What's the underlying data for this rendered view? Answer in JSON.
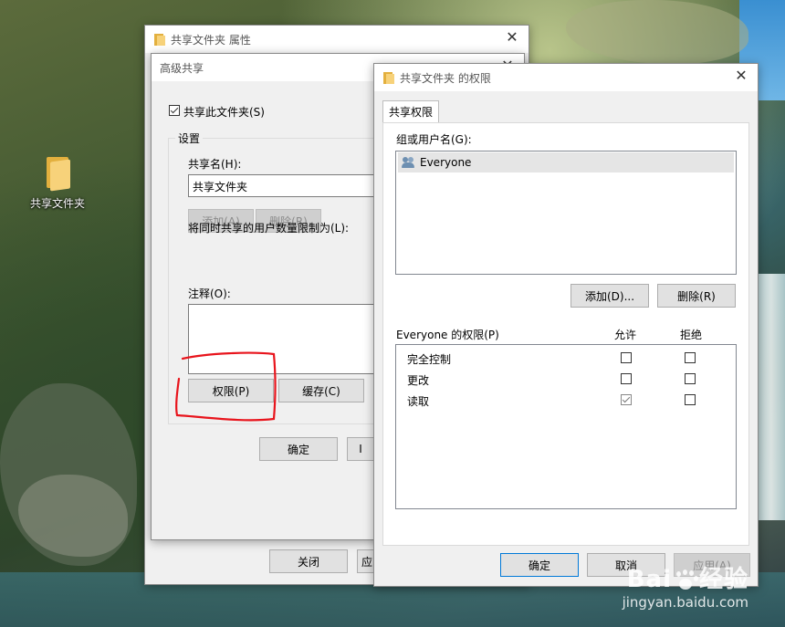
{
  "desktop": {
    "folder_label": "共享文件夹"
  },
  "properties_window": {
    "title": "共享文件夹 属性",
    "close_label": "关闭",
    "apply_label": "应"
  },
  "advanced_share": {
    "title": "高级共享",
    "share_checkbox_label": "共享此文件夹(S)",
    "share_checked": true,
    "settings_label": "设置",
    "share_name_label": "共享名(H):",
    "share_name_value": "共享文件夹",
    "add_label": "添加(A)",
    "remove_label": "删除(R)",
    "limit_label": "将同时共享的用户数量限制为(L):",
    "comment_label": "注释(O):",
    "comment_value": "",
    "permissions_label": "权限(P)",
    "caching_label": "缓存(C)",
    "ok_label": "确定",
    "cancel_partial": "I"
  },
  "permissions_window": {
    "title": "共享文件夹 的权限",
    "tab_label": "共享权限",
    "group_label": "组或用户名(G):",
    "users": [
      {
        "name": "Everyone",
        "icon": "users-icon"
      }
    ],
    "add_label": "添加(D)...",
    "remove_label": "删除(R)",
    "perm_header": "Everyone 的权限(P)",
    "allow_header": "允许",
    "deny_header": "拒绝",
    "permissions": [
      {
        "name": "完全控制",
        "allow": false,
        "deny": false
      },
      {
        "name": "更改",
        "allow": false,
        "deny": false
      },
      {
        "name": "读取",
        "allow": true,
        "deny": false
      }
    ],
    "ok_label": "确定",
    "cancel_label": "取消",
    "apply_label": "应用(A)"
  },
  "watermark": {
    "brand_left": "Bai",
    "brand_right": "经验",
    "url": "jingyan.baidu.com"
  },
  "colors": {
    "annotation_red": "#e8141c",
    "accent_blue": "#0078d7",
    "folder_yellow": "#f7d27a"
  }
}
